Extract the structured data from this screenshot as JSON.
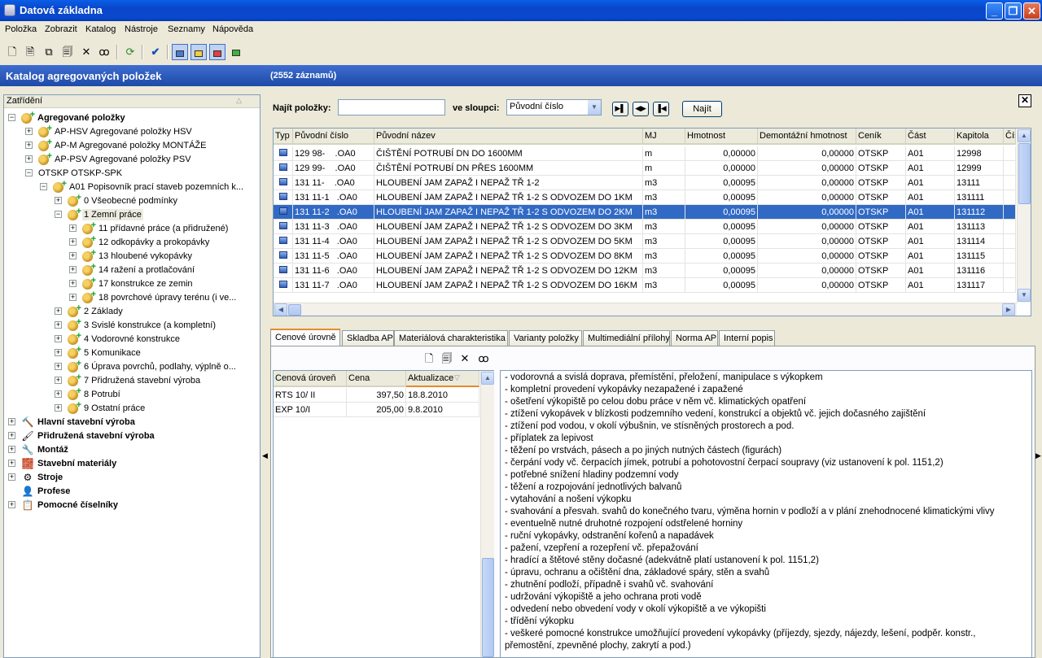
{
  "window": {
    "title": "Datová základna"
  },
  "menu": [
    "Položka",
    "Zobrazit",
    "Katalog",
    "Nástroje",
    "Seznamy",
    "Nápověda"
  ],
  "header": {
    "title": "Katalog agregovaných položek",
    "count": "(2552 záznamů)"
  },
  "tree": {
    "header": "Zatřídění",
    "nodes": [
      {
        "label": "Agregované položky",
        "bold": true
      },
      {
        "label": "AP-HSV Agregované položky HSV"
      },
      {
        "label": "AP-M Agregované položky MONTÁŽE"
      },
      {
        "label": "AP-PSV Agregované položky PSV"
      },
      {
        "label": "OTSKP OTSKP-SPK"
      },
      {
        "label": "A01 Popisovník prací staveb pozemních k..."
      },
      {
        "label": "0 Všeobecné podmínky"
      },
      {
        "label": "1 Zemní práce"
      },
      {
        "label": "11 přídavné práce (a přidružené)"
      },
      {
        "label": "12 odkopávky a prokopávky"
      },
      {
        "label": "13 hloubené vykopávky"
      },
      {
        "label": "14 ražení a protlačování"
      },
      {
        "label": "17 konstrukce ze zemin"
      },
      {
        "label": "18 povrchové úpravy terénu (i ve..."
      },
      {
        "label": "2 Základy"
      },
      {
        "label": "3 Svislé konstrukce (a kompletní)"
      },
      {
        "label": "4 Vodorovné konstrukce"
      },
      {
        "label": "5 Komunikace"
      },
      {
        "label": "6 Úprava povrchů, podlahy, výplně o..."
      },
      {
        "label": "7 Přidružená stavební výroba"
      },
      {
        "label": "8 Potrubí"
      },
      {
        "label": "9 Ostatní práce"
      },
      {
        "label": "Hlavní stavební výroba",
        "bold": true
      },
      {
        "label": "Přidružená stavební výroba",
        "bold": true
      },
      {
        "label": "Montáž",
        "bold": true
      },
      {
        "label": "Stavební materiály",
        "bold": true
      },
      {
        "label": "Stroje",
        "bold": true
      },
      {
        "label": "Profese",
        "bold": true
      },
      {
        "label": "Pomocné číselníky",
        "bold": true
      }
    ]
  },
  "search": {
    "label": "Najít položky:",
    "value": "",
    "column_label": "ve sloupci:",
    "column_value": "Původní číslo",
    "find_button": "Najít"
  },
  "grid": {
    "columns": [
      "Typ",
      "Původní číslo",
      "Původní název",
      "MJ",
      "Hmotnost",
      "Demontážní hmotnost",
      "Ceník",
      "Část",
      "Kapitola",
      "Čís"
    ],
    "rows": [
      {
        "cislo": "129 98-    .OA0",
        "nazev": "ČIŠTĚNÍ POTRUBÍ DN DO 1600MM",
        "mj": "m",
        "hm": "0,00000",
        "dhm": "0,00000",
        "cenik": "OTSKP",
        "cast": "A01",
        "kap": "12998"
      },
      {
        "cislo": "129 99-    .OA0",
        "nazev": "ČIŠTĚNÍ POTRUBÍ DN PŘES 1600MM",
        "mj": "m",
        "hm": "0,00000",
        "dhm": "0,00000",
        "cenik": "OTSKP",
        "cast": "A01",
        "kap": "12999"
      },
      {
        "cislo": "131 11-    .OA0",
        "nazev": "HLOUBENÍ JAM ZAPAŽ I NEPAŽ TŘ 1-2",
        "mj": "m3",
        "hm": "0,00095",
        "dhm": "0,00000",
        "cenik": "OTSKP",
        "cast": "A01",
        "kap": "13111"
      },
      {
        "cislo": "131 11-1   .OA0",
        "nazev": "HLOUBENÍ JAM ZAPAŽ I NEPAŽ TŘ 1-2 S ODVOZEM DO 1KM",
        "mj": "m3",
        "hm": "0,00095",
        "dhm": "0,00000",
        "cenik": "OTSKP",
        "cast": "A01",
        "kap": "131111"
      },
      {
        "cislo": "131 11-2   .OA0",
        "nazev": "HLOUBENÍ JAM ZAPAŽ I NEPAŽ TŘ 1-2 S ODVOZEM DO 2KM",
        "mj": "m3",
        "hm": "0,00095",
        "dhm": "0,00000",
        "cenik": "OTSKP",
        "cast": "A01",
        "kap": "131112",
        "selected": true
      },
      {
        "cislo": "131 11-3   .OA0",
        "nazev": "HLOUBENÍ JAM ZAPAŽ I NEPAŽ TŘ 1-2 S ODVOZEM DO 3KM",
        "mj": "m3",
        "hm": "0,00095",
        "dhm": "0,00000",
        "cenik": "OTSKP",
        "cast": "A01",
        "kap": "131113"
      },
      {
        "cislo": "131 11-4   .OA0",
        "nazev": "HLOUBENÍ JAM ZAPAŽ I NEPAŽ TŘ 1-2 S ODVOZEM DO 5KM",
        "mj": "m3",
        "hm": "0,00095",
        "dhm": "0,00000",
        "cenik": "OTSKP",
        "cast": "A01",
        "kap": "131114"
      },
      {
        "cislo": "131 11-5   .OA0",
        "nazev": "HLOUBENÍ JAM ZAPAŽ I NEPAŽ TŘ 1-2 S ODVOZEM DO 8KM",
        "mj": "m3",
        "hm": "0,00095",
        "dhm": "0,00000",
        "cenik": "OTSKP",
        "cast": "A01",
        "kap": "131115"
      },
      {
        "cislo": "131 11-6   .OA0",
        "nazev": "HLOUBENÍ JAM ZAPAŽ I NEPAŽ TŘ 1-2 S ODVOZEM DO 12KM",
        "mj": "m3",
        "hm": "0,00095",
        "dhm": "0,00000",
        "cenik": "OTSKP",
        "cast": "A01",
        "kap": "131116"
      },
      {
        "cislo": "131 11-7   .OA0",
        "nazev": "HLOUBENÍ JAM ZAPAŽ I NEPAŽ TŘ 1-2 S ODVOZEM DO 16KM",
        "mj": "m3",
        "hm": "0,00095",
        "dhm": "0,00000",
        "cenik": "OTSKP",
        "cast": "A01",
        "kap": "131117"
      }
    ]
  },
  "tabs": [
    "Cenové úrovně",
    "Skladba AP",
    "Materiálová charakteristika",
    "Varianty položky",
    "Multimediální přílohy",
    "Norma AP",
    "Interní popis"
  ],
  "prices": {
    "columns": [
      "Cenová úroveň",
      "Cena",
      "Aktualizace"
    ],
    "rows": [
      {
        "level": "RTS 10/ II",
        "price": "397,50",
        "date": "18.8.2010"
      },
      {
        "level": "EXP 10/I",
        "price": "205,00",
        "date": "9.8.2010"
      }
    ]
  },
  "description": [
    "- vodorovná a svislá doprava, přemístění, přeložení, manipulace s výkopkem",
    "- kompletní provedení vykopávky nezapažené i zapažené",
    "- ošetření výkopiště po celou dobu práce v něm vč. klimatických opatření",
    "- ztížení vykopávek v blízkosti podzemního vedení, konstrukcí a objektů vč. jejich dočasného zajištění",
    "- ztížení pod vodou, v okolí výbušnin, ve stísněných prostorech a pod.",
    "- příplatek za lepivost",
    "- těžení po vrstvách, pásech a po jiných nutných částech (figurách)",
    "- čerpání vody vč. čerpacích jímek, potrubí a pohotovostní čerpací soupravy (viz ustanovení k pol. 1151,2)",
    "- potřebné snížení hladiny podzemní vody",
    "- těžení a rozpojování jednotlivých balvanů",
    "- vytahování a nošení výkopku",
    "- svahování a přesvah. svahů do konečného tvaru, výměna hornin v podloží a v plání znehodnocené klimatickými vlivy",
    "- eventuelně nutné druhotné rozpojení odstřelené horniny",
    "- ruční vykopávky, odstranění kořenů a napadávek",
    "- pažení, vzepření a rozepření vč. přepažování",
    "- hradící a štětové stěny dočasné (adekvátně platí ustanovení k pol. 1151,2)",
    "- úpravu, ochranu a očištění dna, základové spáry, stěn a svahů",
    "- zhutnění podloží, případně i svahů vč. svahování",
    "- udržování výkopiště a jeho ochrana proti vodě",
    "- odvedení nebo obvedení vody v okolí výkopiště a ve výkopišti",
    "- třídění výkopku",
    "- veškeré pomocné konstrukce umožňující provedení vykopávky (příjezdy, sjezdy, nájezdy, lešení, podpěr. konstr.,",
    "přemostění, zpevněné plochy, zakrytí a pod.)"
  ]
}
